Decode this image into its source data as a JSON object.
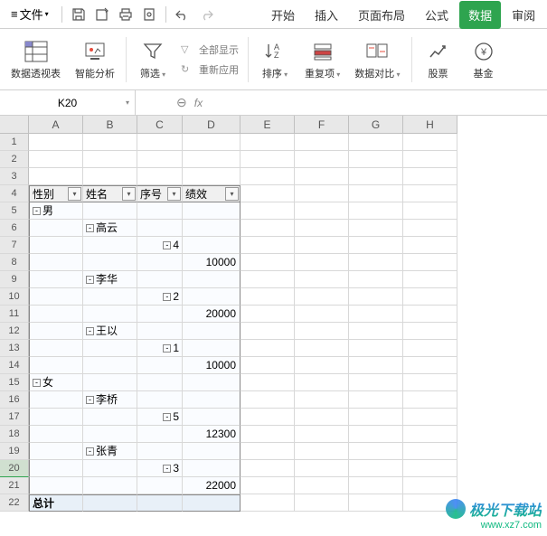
{
  "menu": {
    "file": "文件"
  },
  "tabs": {
    "start": "开始",
    "insert": "插入",
    "layout": "页面布局",
    "formula": "公式",
    "data": "数据",
    "review": "审阅"
  },
  "ribbon": {
    "pivot": "数据透视表",
    "smart": "智能分析",
    "filter": "筛选",
    "show_all": "全部显示",
    "reapply": "重新应用",
    "sort": "排序",
    "dup": "重复项",
    "compare": "数据对比",
    "stock": "股票",
    "fund": "基金"
  },
  "namebox": "K20",
  "fx": "fx",
  "pivot": {
    "headers": [
      "性别",
      "姓名",
      "序号",
      "绩效"
    ],
    "rows": [
      {
        "type": "group1",
        "col1": "男"
      },
      {
        "type": "group2",
        "col2": "高云"
      },
      {
        "type": "group3",
        "col3": "4"
      },
      {
        "type": "value",
        "col4": "10000"
      },
      {
        "type": "group2",
        "col2": "李华"
      },
      {
        "type": "group3",
        "col3": "2"
      },
      {
        "type": "value",
        "col4": "20000"
      },
      {
        "type": "group2",
        "col2": "王以"
      },
      {
        "type": "group3",
        "col3": "1"
      },
      {
        "type": "value",
        "col4": "10000"
      },
      {
        "type": "group1",
        "col1": "女"
      },
      {
        "type": "group2",
        "col2": "李桥"
      },
      {
        "type": "group3",
        "col3": "5"
      },
      {
        "type": "value",
        "col4": "12300"
      },
      {
        "type": "group2",
        "col2": "张青"
      },
      {
        "type": "group3",
        "col3": "3"
      },
      {
        "type": "value",
        "col4": "22000"
      }
    ],
    "total": "总计"
  },
  "watermark": {
    "name": "极光下载站",
    "url": "www.xz7.com"
  }
}
